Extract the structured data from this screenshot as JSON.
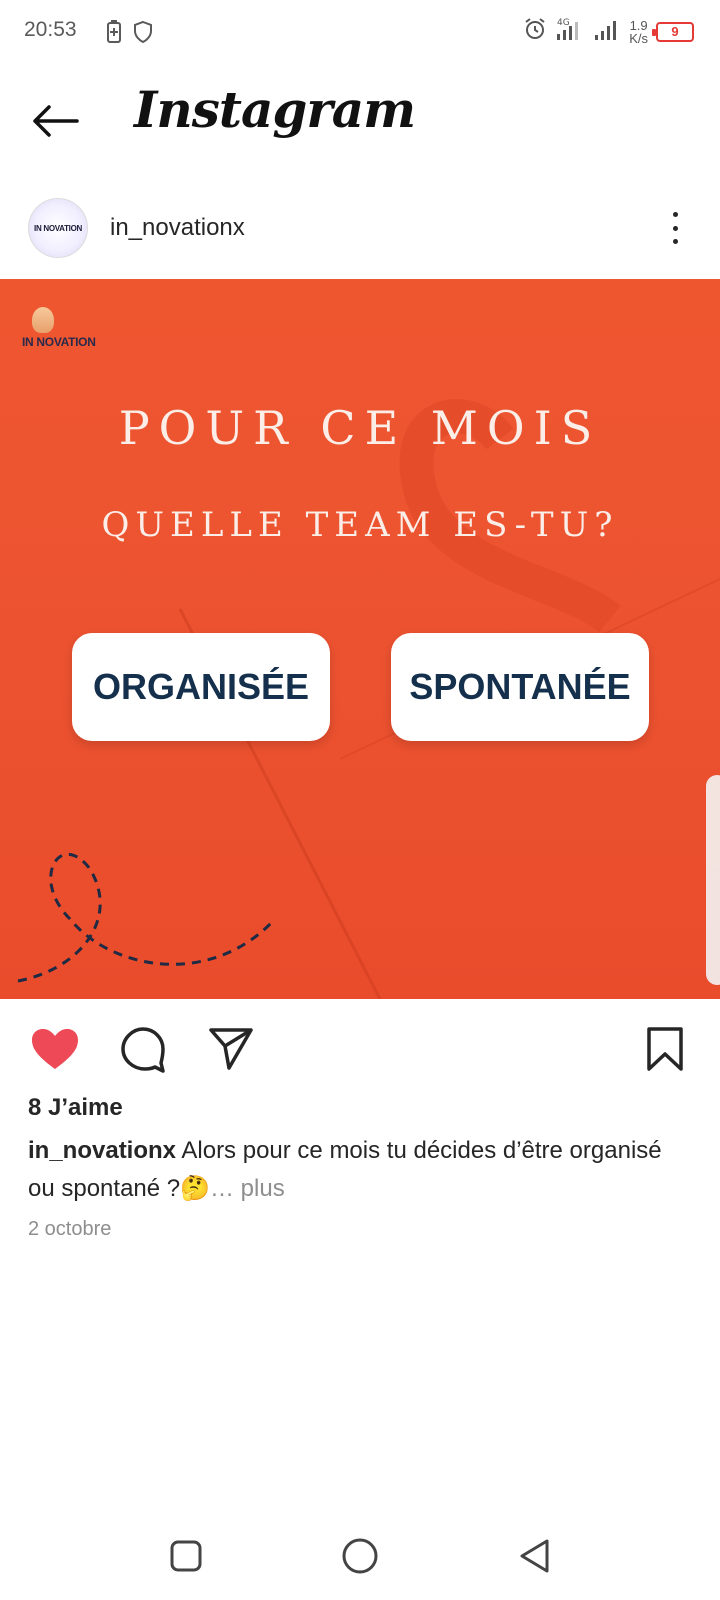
{
  "status_bar": {
    "time": "20:53",
    "net_speed_value": "1.9",
    "net_speed_unit": "K/s",
    "network_label": "4G",
    "battery_level": "9"
  },
  "header": {
    "title": "Instagram",
    "back_icon": "arrow-left-icon"
  },
  "post": {
    "avatar_text": "IN NOVATION",
    "username": "in_novationx",
    "image": {
      "brand": "IN NOVATION",
      "headline_1": "POUR CE MOIS",
      "headline_2": "QUELLE TEAM ES-TU?",
      "option_1": "ORGANISÉE",
      "option_2": "SPONTANÉE",
      "background_color": "#ee5630",
      "button_text_color": "#15304c"
    },
    "actions": {
      "like_icon": "heart-filled-icon",
      "comment_icon": "comment-icon",
      "share_icon": "send-icon",
      "save_icon": "bookmark-icon",
      "liked": true,
      "like_color": "#ed4956"
    },
    "likes_text": "8 J’aime",
    "caption_user": "in_novationx",
    "caption_text": " Alors pour ce mois tu décides d’être organisé ou spontané ?🤔",
    "caption_more": "… plus",
    "date": "2 octobre"
  },
  "navbar": {
    "recents_icon": "square-icon",
    "home_icon": "circle-icon",
    "back_icon": "triangle-back-icon"
  }
}
